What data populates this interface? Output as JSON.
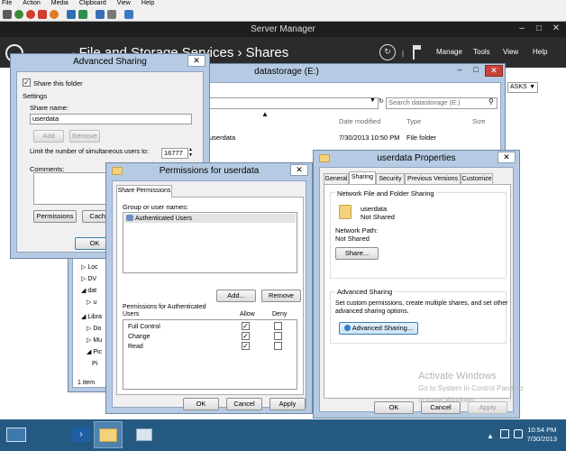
{
  "vm_menu": [
    "File",
    "Action",
    "Media",
    "Clipboard",
    "View",
    "Help"
  ],
  "server_manager": {
    "title": "Server Manager",
    "breadcrumb_1": "File and Storage Services",
    "breadcrumb_sep": "›",
    "breadcrumb_2": "Shares",
    "menu_manage": "Manage",
    "menu_tools": "Tools",
    "menu_view": "View",
    "menu_help": "Help",
    "tasks_label": "ASKS"
  },
  "explorer": {
    "title": "datastorage (E:)",
    "address": "ge (E:)",
    "search_placeholder": "Search datastorage (E:)",
    "col_date": "Date modified",
    "col_type": "Type",
    "col_size": "Size",
    "row_name": "userdata",
    "row_date": "7/30/2013 10:50 PM",
    "row_type": "File folder",
    "tree": [
      "Loc",
      "DV",
      "dat",
      "u",
      "Libra",
      "Do",
      "Mu",
      "Pic",
      "Pi"
    ],
    "status": "1 item"
  },
  "advanced_sharing": {
    "title": "Advanced Sharing",
    "share_checkbox": "Share this folder",
    "settings": "Settings",
    "share_name_label": "Share name:",
    "share_name_value": "userdata",
    "add": "Add",
    "remove": "Remove",
    "limit_label": "Limit the number of simultaneous users to:",
    "limit_value": "16777",
    "comments_label": "Comments:",
    "permissions_btn": "Permissions",
    "caching_btn": "Cachi",
    "ok": "OK"
  },
  "permissions": {
    "title": "Permissions for userdata",
    "tab": "Share Permissions",
    "group_label": "Group or user names:",
    "group_item": "Authenticated Users",
    "add": "Add...",
    "remove": "Remove",
    "perm_label_1": "Permissions for Authenticated",
    "perm_label_2": "Users",
    "allow": "Allow",
    "deny": "Deny",
    "rows": [
      {
        "name": "Full Control",
        "allow": true,
        "deny": false
      },
      {
        "name": "Change",
        "allow": true,
        "deny": false
      },
      {
        "name": "Read",
        "allow": true,
        "deny": false
      }
    ],
    "ok": "OK",
    "cancel": "Cancel",
    "apply": "Apply"
  },
  "properties": {
    "title": "userdata Properties",
    "tabs": [
      "General",
      "Sharing",
      "Security",
      "Previous Versions",
      "Customize"
    ],
    "nffs_label": "Network File and Folder Sharing",
    "folder_name": "userdata",
    "folder_status": "Not Shared",
    "netpath_label": "Network Path:",
    "netpath_value": "Not Shared",
    "share_btn": "Share...",
    "adv_label": "Advanced Sharing",
    "adv_desc_1": "Set custom permissions, create multiple shares, and set other",
    "adv_desc_2": "advanced sharing options.",
    "adv_btn": "Advanced Sharing...",
    "ok": "OK",
    "cancel": "Cancel",
    "apply": "Apply"
  },
  "watermark": {
    "line1": "Activate Windows",
    "line2": "Go to System in Control Panel to",
    "line3": "activate Windows."
  },
  "clock": {
    "time": "10:54 PM",
    "date": "7/30/2013"
  }
}
